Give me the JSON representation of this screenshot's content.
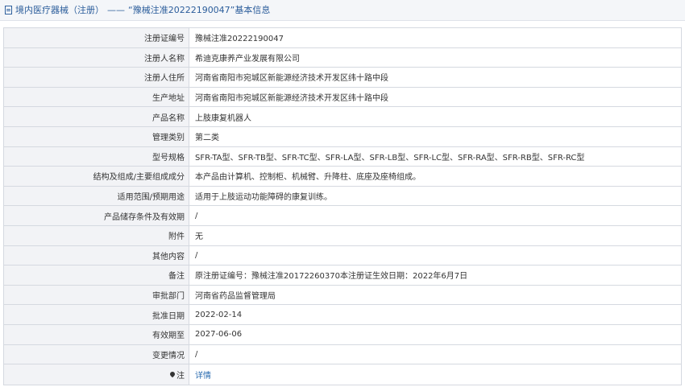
{
  "header": {
    "category": "境内医疗器械（注册）",
    "separator": "——",
    "title": "“豫械注准20222190047”基本信息"
  },
  "rows": [
    {
      "label": "注册证编号",
      "value": "豫械注准20222190047"
    },
    {
      "label": "注册人名称",
      "value": "希迪克康养产业发展有限公司"
    },
    {
      "label": "注册人住所",
      "value": "河南省南阳市宛城区新能源经济技术开发区纬十路中段"
    },
    {
      "label": "生产地址",
      "value": "河南省南阳市宛城区新能源经济技术开发区纬十路中段"
    },
    {
      "label": "产品名称",
      "value": "上肢康复机器人"
    },
    {
      "label": "管理类别",
      "value": "第二类"
    },
    {
      "label": "型号规格",
      "value": "SFR-TA型、SFR-TB型、SFR-TC型、SFR-LA型、SFR-LB型、SFR-LC型、SFR-RA型、SFR-RB型、SFR-RC型"
    },
    {
      "label": "结构及组成/主要组成成分",
      "value": "本产品由计算机、控制柜、机械臂、升降柱、底座及座椅组成。"
    },
    {
      "label": "适用范围/预期用途",
      "value": "适用于上肢运动功能障碍的康复训练。"
    },
    {
      "label": "产品储存条件及有效期",
      "value": "/"
    },
    {
      "label": "附件",
      "value": "无"
    },
    {
      "label": "其他内容",
      "value": "/"
    },
    {
      "label": "备注",
      "value": "原注册证编号：豫械注准20172260370本注册证生效日期：2022年6月7日"
    },
    {
      "label": "审批部门",
      "value": "河南省药品监督管理局"
    },
    {
      "label": "批准日期",
      "value": "2022-02-14"
    },
    {
      "label": "有效期至",
      "value": "2027-06-06"
    },
    {
      "label": "变更情况",
      "value": "/"
    }
  ],
  "note_row": {
    "label": "注",
    "link": "详情"
  }
}
